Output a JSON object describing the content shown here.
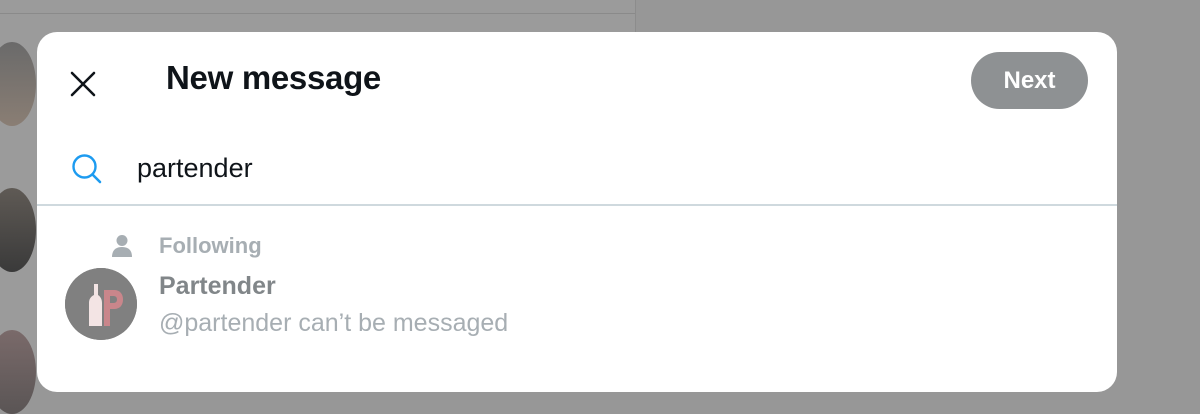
{
  "modal": {
    "title": "New message",
    "next_label": "Next"
  },
  "search": {
    "value": "partender"
  },
  "results": {
    "section_label": "Following",
    "users": [
      {
        "name": "Partender",
        "status": "@partender can’t be messaged"
      }
    ]
  },
  "colors": {
    "accent": "#1d9bf0",
    "next_button_disabled": "#8e9193",
    "overlay": "#979797"
  },
  "icons": {
    "close": "close-icon",
    "search": "search-icon",
    "section": "person-icon"
  }
}
